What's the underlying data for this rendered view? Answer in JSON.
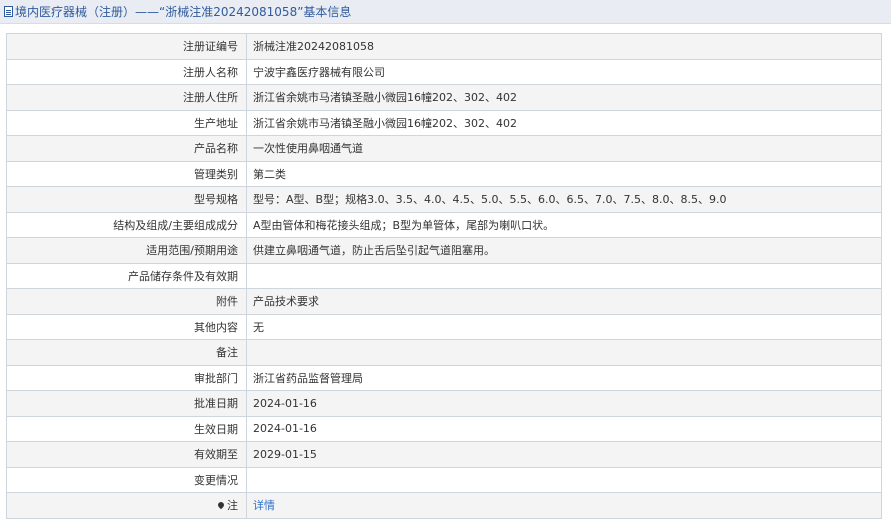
{
  "header": {
    "title": "境内医疗器械（注册）——“浙械注准20242081058”基本信息"
  },
  "rows": [
    {
      "label": "注册证编号",
      "value": "浙械注准20242081058"
    },
    {
      "label": "注册人名称",
      "value": "宁波宇鑫医疗器械有限公司"
    },
    {
      "label": "注册人住所",
      "value": "浙江省余姚市马渚镇圣融小微园16幢202、302、402"
    },
    {
      "label": "生产地址",
      "value": "浙江省余姚市马渚镇圣融小微园16幢202、302、402"
    },
    {
      "label": "产品名称",
      "value": "一次性使用鼻咽通气道"
    },
    {
      "label": "管理类别",
      "value": "第二类"
    },
    {
      "label": "型号规格",
      "value": "型号：A型、B型；规格3.0、3.5、4.0、4.5、5.0、5.5、6.0、6.5、7.0、7.5、8.0、8.5、9.0"
    },
    {
      "label": "结构及组成/主要组成成分",
      "value": "A型由管体和梅花接头组成；B型为单管体，尾部为喇叭口状。"
    },
    {
      "label": "适用范围/预期用途",
      "value": "供建立鼻咽通气道，防止舌后坠引起气道阻塞用。"
    },
    {
      "label": "产品储存条件及有效期",
      "value": ""
    },
    {
      "label": "附件",
      "value": "产品技术要求"
    },
    {
      "label": "其他内容",
      "value": "无"
    },
    {
      "label": "备注",
      "value": ""
    },
    {
      "label": "审批部门",
      "value": "浙江省药品监督管理局"
    },
    {
      "label": "批准日期",
      "value": "2024-01-16"
    },
    {
      "label": "生效日期",
      "value": "2024-01-16"
    },
    {
      "label": "有效期至",
      "value": "2029-01-15"
    },
    {
      "label": "变更情况",
      "value": ""
    }
  ],
  "note": {
    "label": "注",
    "icon": "pin-icon",
    "link_text": "详情"
  }
}
